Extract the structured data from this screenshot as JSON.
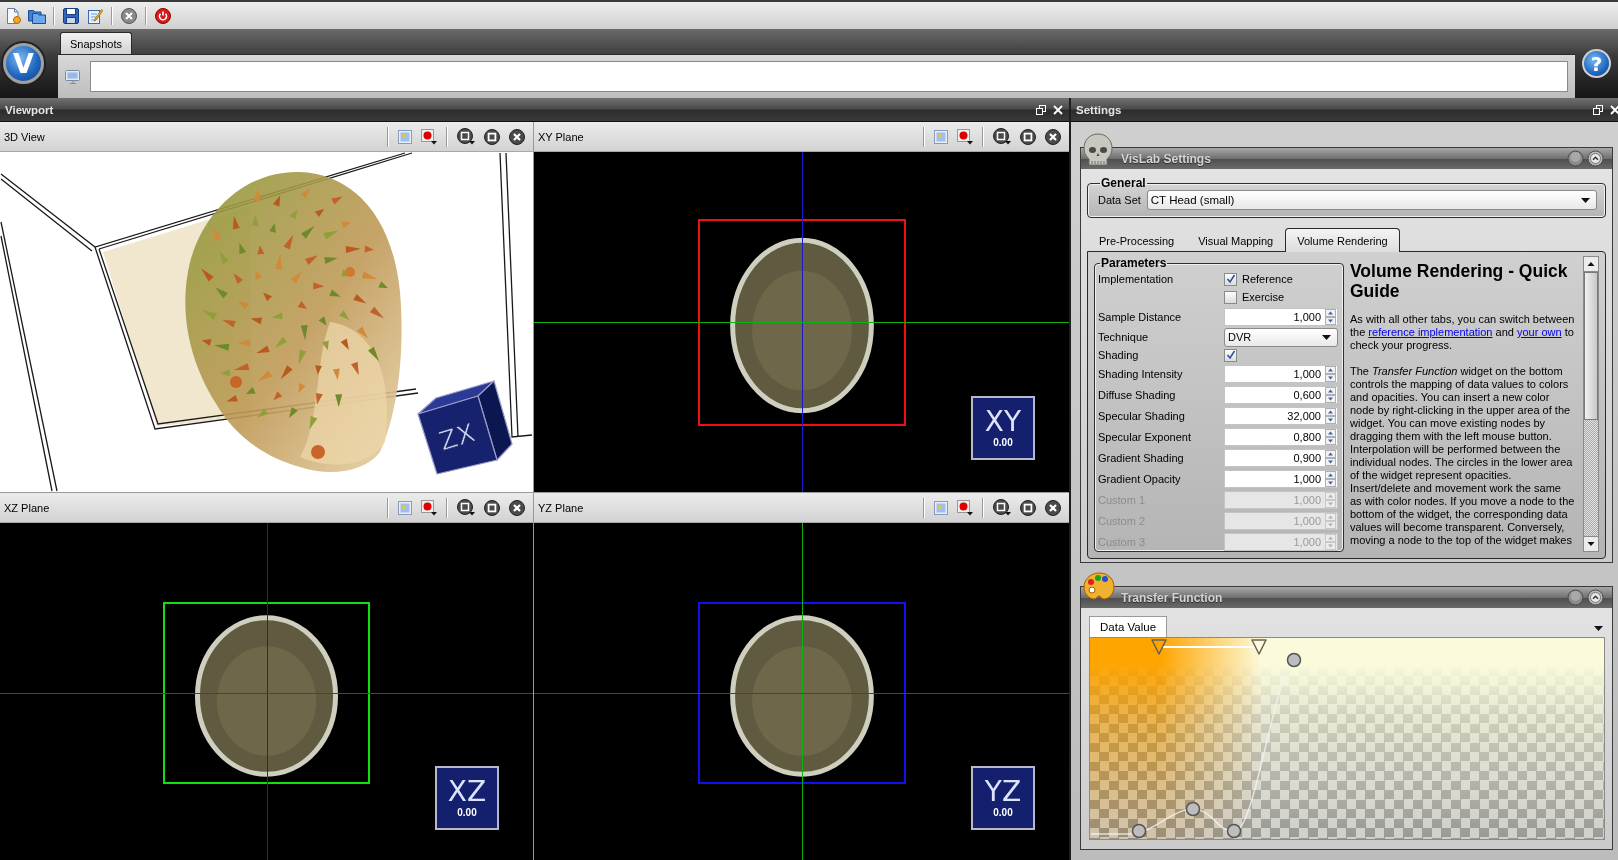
{
  "app_logo": "V",
  "snapshots": {
    "tabs": [
      {
        "label": "Snapshots",
        "selected": true
      }
    ]
  },
  "help": "?",
  "viewport": {
    "title": "Viewport",
    "views": [
      {
        "title": "3D View",
        "kind": "volume",
        "cube_label": "ZX"
      },
      {
        "title": "XY Plane",
        "kind": "slice",
        "label": "XY",
        "value": "0.00",
        "color": "#f01010",
        "crosshairs": [
          {
            "kind": "vertical",
            "color": "#1a1ad0"
          },
          {
            "kind": "horizontal",
            "color": "#10b010"
          }
        ]
      },
      {
        "title": "XZ Plane",
        "kind": "slice",
        "label": "XZ",
        "value": "0.00",
        "color": "#10e010",
        "crosshairs": [
          {
            "kind": "vertical",
            "color": "#1a1ad0"
          },
          {
            "kind": "horizontal",
            "color": "#c01010"
          }
        ]
      },
      {
        "title": "YZ Plane",
        "kind": "slice",
        "label": "YZ",
        "value": "0.00",
        "color": "#1010f0",
        "crosshairs": [
          {
            "kind": "vertical",
            "color": "#10b010"
          },
          {
            "kind": "horizontal",
            "color": "#c01010"
          }
        ]
      }
    ]
  },
  "settings": {
    "title": "Settings",
    "vislab": {
      "title": "VisLab Settings",
      "general": {
        "title": "General",
        "data_set_label": "Data Set",
        "data_set": "CT Head (small)"
      },
      "tabs": [
        {
          "label": "Pre-Processing",
          "selected": false
        },
        {
          "label": "Visual Mapping",
          "selected": false
        },
        {
          "label": "Volume Rendering",
          "selected": true
        }
      ],
      "parameters": {
        "title": "Parameters",
        "rows": [
          {
            "label": "Implementation",
            "kind": "checks",
            "disabled": false,
            "options": [
              {
                "label": "Reference",
                "checked": true
              },
              {
                "label": "Exercise",
                "checked": false
              }
            ]
          },
          {
            "label": "Sample Distance",
            "kind": "spin",
            "disabled": false,
            "value": "1,000"
          },
          {
            "label": "Technique",
            "kind": "combo",
            "disabled": false,
            "value": "DVR"
          },
          {
            "label": "Shading",
            "kind": "check",
            "disabled": false,
            "checked": true
          },
          {
            "label": "Shading Intensity",
            "kind": "spin",
            "disabled": false,
            "value": "1,000"
          },
          {
            "label": "Diffuse Shading",
            "kind": "spin",
            "disabled": false,
            "value": "0,600"
          },
          {
            "label": "Specular Shading",
            "kind": "spin",
            "disabled": false,
            "value": "32,000"
          },
          {
            "label": "Specular Exponent",
            "kind": "spin",
            "disabled": false,
            "value": "0,800"
          },
          {
            "label": "Gradient Shading",
            "kind": "spin",
            "disabled": false,
            "value": "0,900"
          },
          {
            "label": "Gradient Opacity",
            "kind": "spin",
            "disabled": false,
            "value": "1,000"
          },
          {
            "label": "Custom 1",
            "kind": "spin",
            "disabled": true,
            "value": "1,000"
          },
          {
            "label": "Custom 2",
            "kind": "spin",
            "disabled": true,
            "value": "1,000"
          },
          {
            "label": "Custom 3",
            "kind": "spin",
            "disabled": true,
            "value": "1,000"
          }
        ]
      },
      "guide": {
        "heading": "Volume Rendering - Quick Guide",
        "paragraphs": [
          {
            "parts": [
              {
                "kind": "text",
                "text": "As with all other tabs, you can switch between the "
              },
              {
                "kind": "link",
                "text": "reference implementation"
              },
              {
                "kind": "text",
                "text": " and "
              },
              {
                "kind": "link",
                "text": "your own"
              },
              {
                "kind": "text",
                "text": " to check your progress."
              }
            ]
          },
          {
            "parts": [
              {
                "kind": "text",
                "text": "The *Transfer Function* widget on the bottom controls the mapping of data values to colors and opacities. You can insert a new color node by right-clicking in the upper area of the widget. You can move existing nodes by dragging them with the left mouse button. Interpolation will be performed between the individual nodes. The circles in the lower area of the widget represent opacities. Insert/delete and movement work the same as with color nodes. If you move a node to the bottom of the widget, the corresponding data values will become transparent. Conversely, moving a node to the top of the widget makes"
              }
            ]
          }
        ]
      }
    },
    "transfer_function": {
      "title": "Transfer Function",
      "tabs": [
        {
          "label": "Data Value",
          "selected": true
        }
      ],
      "color_nodes": [
        {
          "color": "#ffa500"
        },
        {
          "color": "#fbfbdc"
        }
      ]
    }
  }
}
